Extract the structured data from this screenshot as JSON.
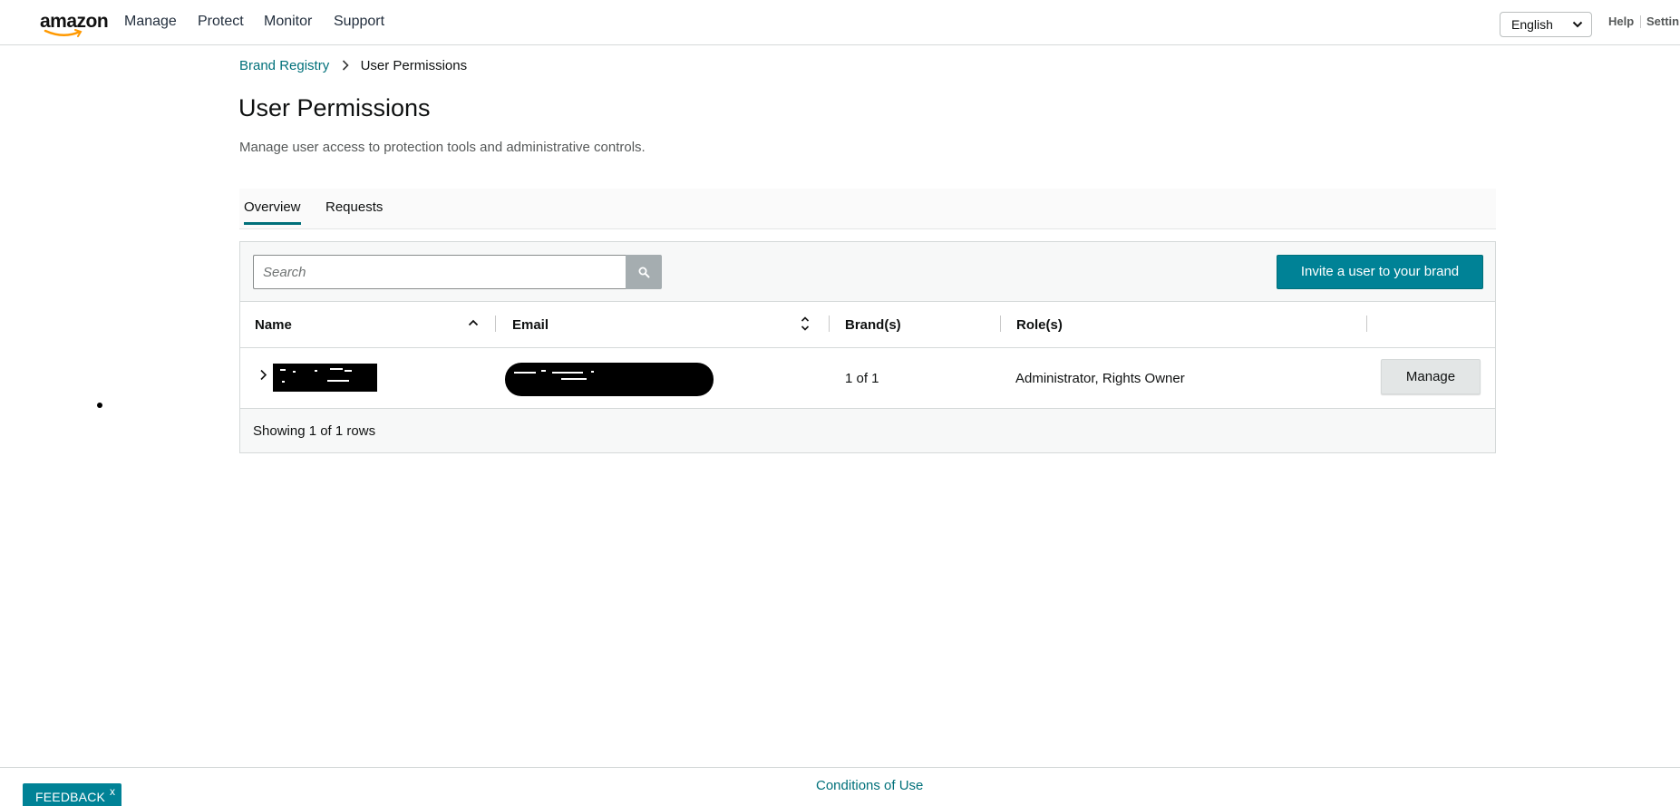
{
  "nav": {
    "logo_text": "amazon",
    "links": [
      "Manage",
      "Protect",
      "Monitor",
      "Support"
    ],
    "language": "English",
    "help_label": "Help",
    "settings_label": "Settin"
  },
  "breadcrumb": {
    "parent": "Brand Registry",
    "current": "User Permissions"
  },
  "page": {
    "title": "User Permissions",
    "description": "Manage user access to protection tools and administrative controls."
  },
  "tabs": [
    {
      "label": "Overview",
      "active": true
    },
    {
      "label": "Requests",
      "active": false
    }
  ],
  "search": {
    "placeholder": "Search",
    "value": "",
    "icon": "search-icon"
  },
  "toolbar": {
    "invite_label": "Invite a user to your brand"
  },
  "table": {
    "columns": [
      "Name",
      "Email",
      "Brand(s)",
      "Role(s)"
    ],
    "rows": [
      {
        "name": "[redacted]",
        "email": "[redacted]",
        "brands": "1 of 1",
        "roles": "Administrator, Rights Owner",
        "action_label": "Manage"
      }
    ],
    "footer": "Showing 1 of 1 rows"
  },
  "footer": {
    "conditions_label": "Conditions of Use",
    "feedback_label": "FEEDBACK",
    "feedback_close": "x"
  },
  "colors": {
    "accent": "#008296",
    "link": "#00707a",
    "text": "#0f1111",
    "muted": "#565959",
    "secondary_button": "#e3e6e6"
  }
}
